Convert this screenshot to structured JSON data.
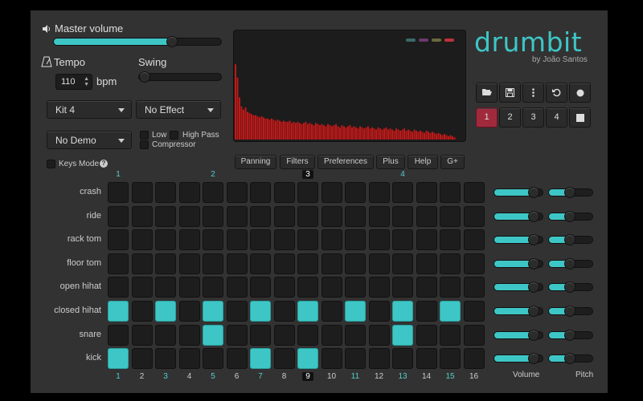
{
  "master_volume": {
    "label": "Master volume",
    "level": 0.72
  },
  "tempo": {
    "label": "Tempo",
    "value": "110",
    "unit": "bpm"
  },
  "swing": {
    "label": "Swing",
    "level": 0.0
  },
  "kit_select": {
    "value": "Kit 4"
  },
  "effect_select": {
    "value": "No Effect"
  },
  "demo_select": {
    "value": "No Demo"
  },
  "filters": {
    "low": "Low",
    "high_pass": "High Pass",
    "compressor": "Compressor"
  },
  "keys_mode": {
    "label": "Keys Mode",
    "help": "?"
  },
  "brand": {
    "title": "drumbit",
    "byline": "by João Santos"
  },
  "legend_colors": [
    "#3a6a6a",
    "#6a3a6a",
    "#6a6a3a",
    "#c0303a"
  ],
  "tabs": [
    "Panning",
    "Filters",
    "Preferences",
    "Plus",
    "Help",
    "G+"
  ],
  "toolbar": {
    "icons": [
      "folder-open-icon",
      "save-icon",
      "more-icon",
      "undo-icon",
      "record-icon"
    ],
    "patterns": [
      "1",
      "2",
      "3",
      "4"
    ],
    "active_pattern": "1",
    "stop_icon": "stop-icon"
  },
  "spectrum": {
    "bar_color": "#c01818",
    "levels": [
      0.68,
      0.56,
      0.38,
      0.3,
      0.27,
      0.29,
      0.25,
      0.24,
      0.23,
      0.22,
      0.22,
      0.21,
      0.2,
      0.21,
      0.2,
      0.19,
      0.19,
      0.18,
      0.19,
      0.18,
      0.17,
      0.18,
      0.17,
      0.16,
      0.17,
      0.16,
      0.16,
      0.17,
      0.15,
      0.16,
      0.15,
      0.16,
      0.15,
      0.14,
      0.15,
      0.16,
      0.14,
      0.15,
      0.14,
      0.13,
      0.15,
      0.14,
      0.13,
      0.14,
      0.13,
      0.12,
      0.14,
      0.13,
      0.12,
      0.13,
      0.14,
      0.12,
      0.11,
      0.13,
      0.12,
      0.11,
      0.12,
      0.13,
      0.11,
      0.12,
      0.11,
      0.1,
      0.12,
      0.11,
      0.1,
      0.11,
      0.12,
      0.1,
      0.11,
      0.1,
      0.09,
      0.11,
      0.1,
      0.09,
      0.1,
      0.11,
      0.09,
      0.1,
      0.09,
      0.08,
      0.1,
      0.09,
      0.08,
      0.09,
      0.1,
      0.08,
      0.09,
      0.08,
      0.07,
      0.09,
      0.08,
      0.07,
      0.08,
      0.07,
      0.06,
      0.08,
      0.07,
      0.06,
      0.07,
      0.06,
      0.05,
      0.06,
      0.05,
      0.04,
      0.05,
      0.04,
      0.03,
      0.04,
      0.03,
      0.02
    ]
  },
  "beats": [
    "1",
    "2",
    "3",
    "4"
  ],
  "current_beat": "3",
  "steps": [
    "1",
    "2",
    "3",
    "4",
    "5",
    "6",
    "7",
    "8",
    "9",
    "10",
    "11",
    "12",
    "13",
    "14",
    "15",
    "16"
  ],
  "current_step": "9",
  "instruments": [
    {
      "name": "crash",
      "pattern": [
        0,
        0,
        0,
        0,
        0,
        0,
        0,
        0,
        0,
        0,
        0,
        0,
        0,
        0,
        0,
        0
      ],
      "volume": 0.88,
      "pitch": 0.45
    },
    {
      "name": "ride",
      "pattern": [
        0,
        0,
        0,
        0,
        0,
        0,
        0,
        0,
        0,
        0,
        0,
        0,
        0,
        0,
        0,
        0
      ],
      "volume": 0.88,
      "pitch": 0.45
    },
    {
      "name": "rack tom",
      "pattern": [
        0,
        0,
        0,
        0,
        0,
        0,
        0,
        0,
        0,
        0,
        0,
        0,
        0,
        0,
        0,
        0
      ],
      "volume": 0.88,
      "pitch": 0.45
    },
    {
      "name": "floor tom",
      "pattern": [
        0,
        0,
        0,
        0,
        0,
        0,
        0,
        0,
        0,
        0,
        0,
        0,
        0,
        0,
        0,
        0
      ],
      "volume": 0.88,
      "pitch": 0.45
    },
    {
      "name": "open hihat",
      "pattern": [
        0,
        0,
        0,
        0,
        0,
        0,
        0,
        0,
        0,
        0,
        0,
        0,
        0,
        0,
        0,
        0
      ],
      "volume": 0.88,
      "pitch": 0.45
    },
    {
      "name": "closed hihat",
      "pattern": [
        1,
        0,
        1,
        0,
        1,
        0,
        1,
        0,
        1,
        0,
        1,
        0,
        1,
        0,
        1,
        0
      ],
      "volume": 0.88,
      "pitch": 0.45
    },
    {
      "name": "snare",
      "pattern": [
        0,
        0,
        0,
        0,
        1,
        0,
        0,
        0,
        0,
        0,
        0,
        0,
        1,
        0,
        0,
        0
      ],
      "volume": 0.88,
      "pitch": 0.45
    },
    {
      "name": "kick",
      "pattern": [
        1,
        0,
        0,
        0,
        0,
        0,
        1,
        0,
        1,
        0,
        0,
        0,
        0,
        0,
        0,
        0
      ],
      "volume": 0.88,
      "pitch": 0.45
    }
  ],
  "column_labels": {
    "volume": "Volume",
    "pitch": "Pitch"
  }
}
